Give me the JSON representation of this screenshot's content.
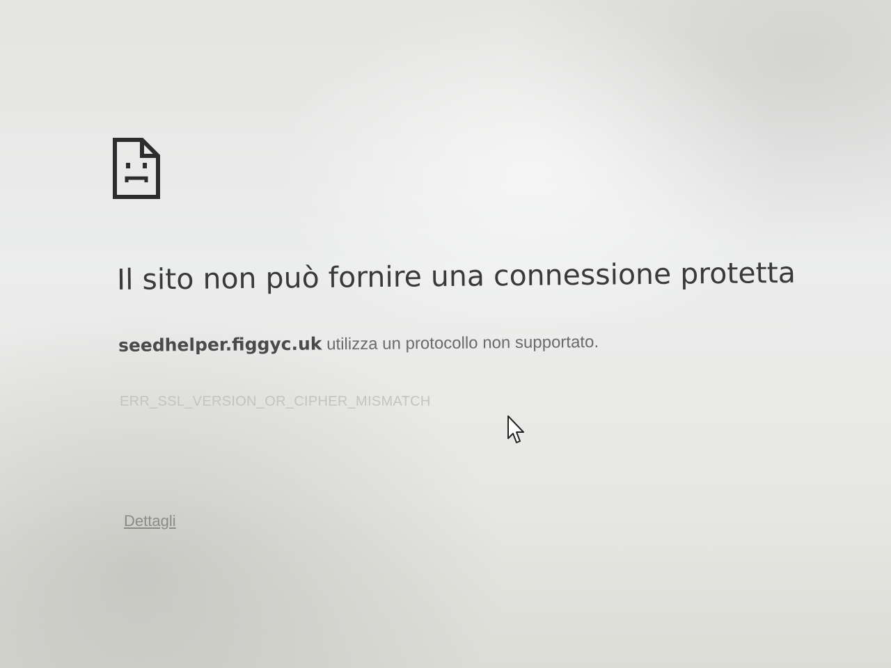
{
  "page": {
    "icon": "sad-page-icon",
    "heading": "Il sito non può fornire una connessione protetta",
    "hostname": "seedhelper.figgyc.uk",
    "explanation_suffix": " utilizza un protocollo non supportato.",
    "error_code": "ERR_SSL_VERSION_OR_CIPHER_MISMATCH",
    "details_link": "Dettagli"
  },
  "cursor": {
    "icon": "mouse-pointer-icon"
  },
  "colors": {
    "background": "#e8e9e6",
    "heading": "#3a3a3a",
    "body_text": "#6b6b6b",
    "error_code": "#c3c3c1",
    "link": "#8a8a88"
  }
}
